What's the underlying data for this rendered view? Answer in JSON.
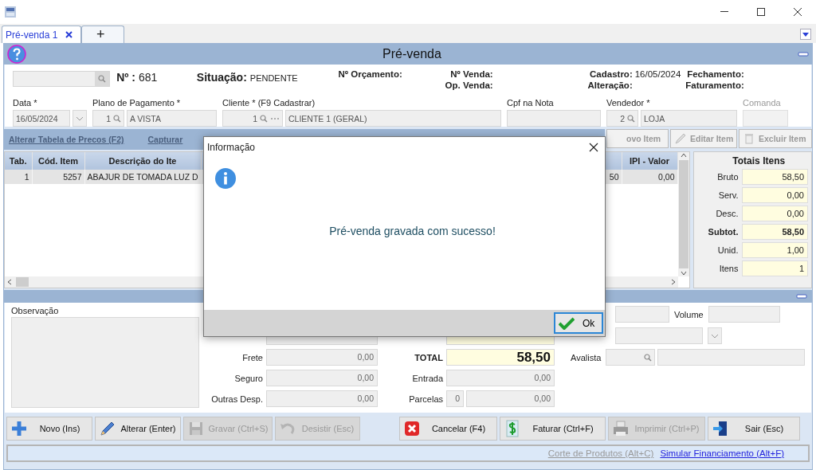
{
  "tabs": [
    {
      "label": "Pré-venda 1",
      "selected": true,
      "closable": true
    },
    {
      "label": "+",
      "selected": false,
      "closable": false
    }
  ],
  "header": {
    "title": "Pré-venda"
  },
  "info": {
    "number_label": "Nº :",
    "number": "681",
    "status_label": "Situação:",
    "status": "PENDENTE",
    "meta_columns": [
      [
        {
          "label": "Nº Orçamento:"
        }
      ],
      [
        {
          "label": "Nº Venda:"
        },
        {
          "label": "Op. Venda:"
        }
      ],
      [
        {
          "label": "Cadastro:",
          "value": "16/05/2024"
        },
        {
          "label": "Alteração:"
        }
      ],
      [
        {
          "label": "Fechamento:"
        },
        {
          "label": "Faturamento:"
        }
      ]
    ],
    "fields": [
      {
        "label": "Data *",
        "kind": "date",
        "value": "16/05/2024",
        "disabled": false
      },
      {
        "label": "Plano de Pagamento *",
        "kind": "lookup",
        "code": "1",
        "value": "A VISTA",
        "disabled": false
      },
      {
        "label": "Cliente * (F9 Cadastrar)",
        "kind": "lookup_more",
        "code": "1",
        "value": "CLIENTE 1 (GERAL)",
        "disabled": false
      },
      {
        "label": "Cpf na Nota",
        "kind": "text",
        "disabled": false
      },
      {
        "label": "Vendedor *",
        "kind": "lookup",
        "code": "2",
        "value": "LOJA",
        "disabled": false
      },
      {
        "label": "Comanda",
        "kind": "text",
        "disabled": true
      }
    ]
  },
  "items_bar": {
    "links": [
      "Alterar Tabela de Precos (F2)",
      "Capturar"
    ],
    "buttons": [
      {
        "label": "ovo Item",
        "kind": "new",
        "disabled": true
      },
      {
        "label": "Editar Item",
        "kind": "edit",
        "disabled": true
      },
      {
        "label": "Excluir Item",
        "kind": "delete",
        "disabled": true
      }
    ]
  },
  "table": {
    "columns": [
      "Tab.",
      "Cód. Item",
      "Descrição do Ite",
      "",
      "",
      "IPI - Valor"
    ],
    "rows": [
      {
        "selected": true,
        "cells": [
          "1",
          "5257",
          "ABAJUR DE TOMADA  LUZ D",
          "",
          "50",
          "0,00"
        ]
      }
    ]
  },
  "totals": {
    "title": "Totais Itens",
    "rows": [
      {
        "label": "Bruto",
        "value": "58,50",
        "bold": false
      },
      {
        "label": "Serv.",
        "value": "0,00",
        "bold": false
      },
      {
        "label": "Desc.",
        "value": "0,00",
        "bold": false
      },
      {
        "label": "Subtot.",
        "value": "58,50",
        "bold": true
      },
      {
        "label": "Unid.",
        "value": "1,00",
        "bold": false
      },
      {
        "label": "Itens",
        "value": "1",
        "bold": false
      }
    ]
  },
  "observation": {
    "label": "Observação"
  },
  "charges": [
    {
      "label": "Frete",
      "value": "0,00"
    },
    {
      "label": "Seguro",
      "value": "0,00"
    },
    {
      "label": "Outras Desp.",
      "value": "0,00"
    }
  ],
  "summary": {
    "total_label": "TOTAL",
    "total": "58,50",
    "entry_label": "Entrada",
    "entry": "0,00",
    "installments_label": "Parcelas",
    "installments_count": "0",
    "installments_value": "0,00"
  },
  "extra": {
    "volume_label": "Volume",
    "guarantor_label": "Avalista"
  },
  "actions": [
    {
      "label": "Novo (Ins)",
      "kind": "plus",
      "disabled": false
    },
    {
      "label": "Alterar (Enter)",
      "kind": "pencil",
      "disabled": false
    },
    {
      "label": "Gravar (Ctrl+S)",
      "kind": "disk",
      "disabled": true
    },
    {
      "label": "Desistir (Esc)",
      "kind": "undo",
      "disabled": true
    },
    {
      "label": "Cancelar (F4)",
      "kind": "cancel",
      "disabled": false
    },
    {
      "label": "Faturar (Ctrl+F)",
      "kind": "money",
      "disabled": false
    },
    {
      "label": "Imprimir (Ctrl+P)",
      "kind": "printer",
      "disabled": true
    },
    {
      "label": "Sair (Esc)",
      "kind": "exit",
      "disabled": false
    }
  ],
  "status_links": [
    {
      "label": "Corte de Produtos (Alt+C)",
      "disabled": true
    },
    {
      "label": "Simular Financiamento (Alt+F)",
      "disabled": false
    }
  ],
  "dialog": {
    "title": "Informação",
    "message": "Pré-venda gravada com sucesso!",
    "button": "Ok"
  }
}
